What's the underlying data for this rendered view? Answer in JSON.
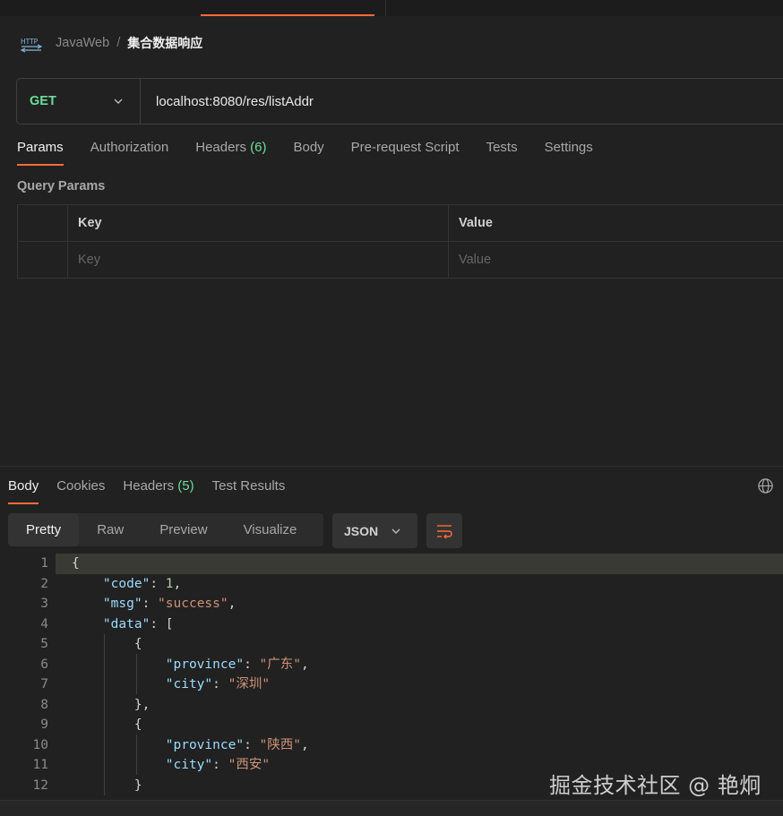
{
  "breadcrumb": {
    "collection": "JavaWeb",
    "separator": "/",
    "request": "集合数据响应"
  },
  "request": {
    "method": "GET",
    "url": "localhost:8080/res/listAddr",
    "tabs": [
      {
        "label": "Params",
        "count": ""
      },
      {
        "label": "Authorization",
        "count": ""
      },
      {
        "label": "Headers",
        "count": "(6)"
      },
      {
        "label": "Body",
        "count": ""
      },
      {
        "label": "Pre-request Script",
        "count": ""
      },
      {
        "label": "Tests",
        "count": ""
      },
      {
        "label": "Settings",
        "count": ""
      }
    ],
    "active_tab": "Params"
  },
  "query_params": {
    "title": "Query Params",
    "headers": {
      "key": "Key",
      "value": "Value"
    },
    "placeholders": {
      "key": "Key",
      "value": "Value"
    }
  },
  "response": {
    "tabs": [
      {
        "label": "Body",
        "count": ""
      },
      {
        "label": "Cookies",
        "count": ""
      },
      {
        "label": "Headers",
        "count": "(5)"
      },
      {
        "label": "Test Results",
        "count": ""
      }
    ],
    "active_tab": "Body",
    "view_modes": [
      "Pretty",
      "Raw",
      "Preview",
      "Visualize"
    ],
    "active_view": "Pretty",
    "format": "JSON",
    "line_numbers": [
      "1",
      "2",
      "3",
      "4",
      "5",
      "6",
      "7",
      "8",
      "9",
      "10",
      "11",
      "12"
    ],
    "code_lines": [
      "{",
      "    \"code\": 1,",
      "    \"msg\": \"success\",",
      "    \"data\": [",
      "        {",
      "            \"province\": \"广东\",",
      "            \"city\": \"深圳\"",
      "        },",
      "        {",
      "            \"province\": \"陕西\",",
      "            \"city\": \"西安\"",
      "        }"
    ]
  },
  "watermark": "掘金技术社区 @ 艳炯",
  "colors": {
    "accent": "#ff6c37",
    "method_get": "#6bdd9a",
    "json_key": "#9cdcfe",
    "json_string": "#ce9178",
    "json_number": "#b5cea8"
  }
}
